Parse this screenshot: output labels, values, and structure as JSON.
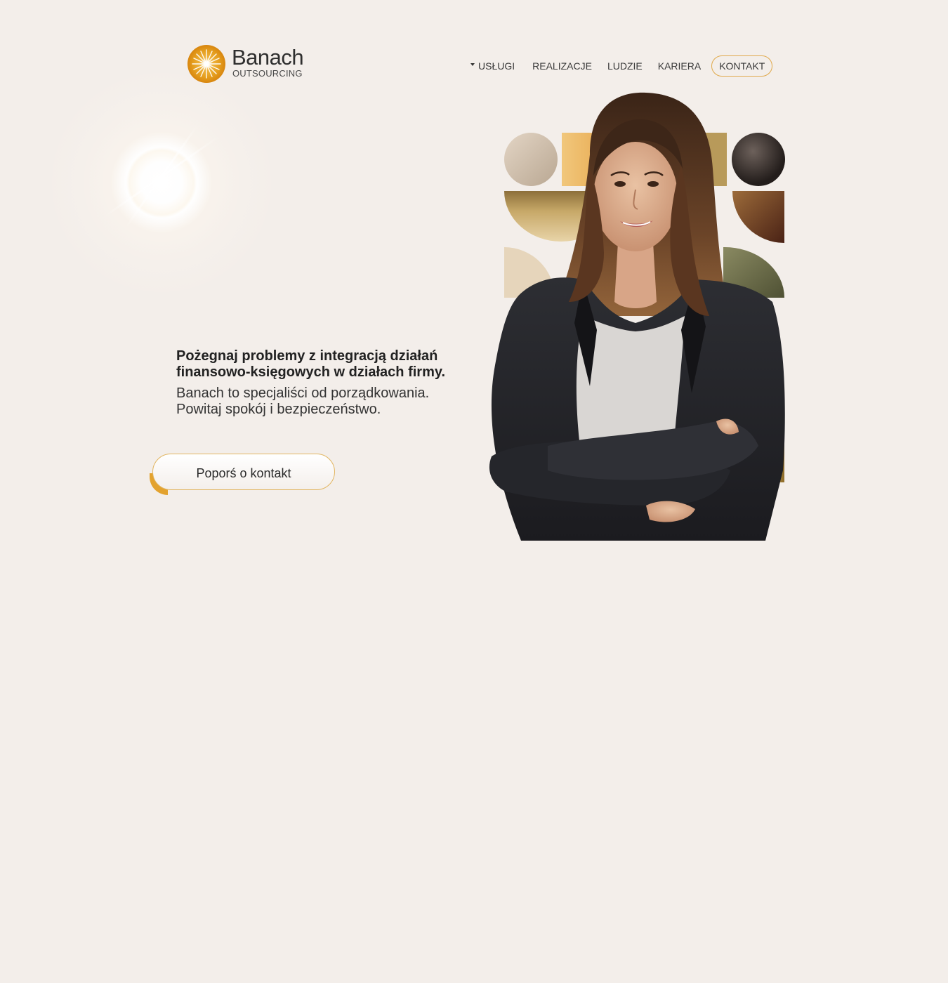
{
  "brand": {
    "name": "Banach",
    "subtitle": "OUTSOURCING",
    "accent_color": "#e3a22e"
  },
  "nav": {
    "items": [
      {
        "label": "USŁUGI",
        "has_dropdown": true
      },
      {
        "label": "REALIZACJE"
      },
      {
        "label": "LUDZIE"
      },
      {
        "label": "KARIERA"
      },
      {
        "label": "KONTAKT"
      }
    ]
  },
  "hero": {
    "heading_lines": [
      "Pożegnaj problemy z integracją działań",
      "finansowo-księgowych w działach firmy."
    ],
    "sub_lines": [
      "Banach to specjaliści od porządkowania.",
      "Powitaj spokój i bezpieczeństwo."
    ],
    "cta_label": "Poporś o kontakt"
  },
  "colors": {
    "background": "#f3eeea",
    "outline_accent": "#e0a94b"
  }
}
